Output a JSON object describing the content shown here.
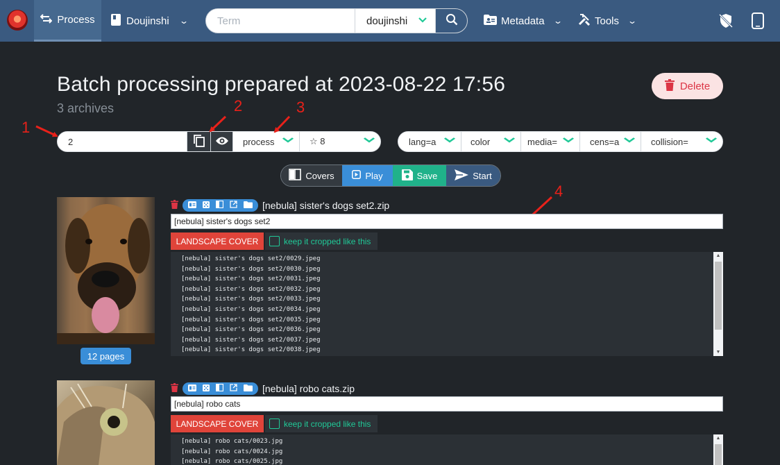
{
  "nav": {
    "process_label": "Process",
    "category_label": "Doujinshi",
    "search_placeholder": "Term",
    "search_category": "doujinshi",
    "metadata_label": "Metadata",
    "tools_label": "Tools"
  },
  "header": {
    "title": "Batch processing prepared at 2023-08-22 17:56",
    "subtitle": "3 archives",
    "delete_label": "Delete"
  },
  "controls": {
    "count_value": "2",
    "mode_select": "process",
    "rating_select": "☆ 8",
    "filters": [
      "lang=a",
      "color",
      "media=",
      "cens=a",
      "collision="
    ]
  },
  "annotations": [
    "1",
    "2",
    "3",
    "4"
  ],
  "actions": {
    "covers_label": "Covers",
    "play_label": "Play",
    "save_label": "Save",
    "start_label": "Start"
  },
  "archives": [
    {
      "filename": "[nebula] sister's dogs set2.zip",
      "title": "[nebula] sister's dogs set2",
      "pages_label": "12 pages",
      "landscape_label": "LANDSCAPE COVER",
      "keep_label": "keep it cropped like this",
      "files": [
        "[nebula] sister's dogs set2/0029.jpeg",
        "[nebula] sister's dogs set2/0030.jpeg",
        "[nebula] sister's dogs set2/0031.jpeg",
        "[nebula] sister's dogs set2/0032.jpeg",
        "[nebula] sister's dogs set2/0033.jpeg",
        "[nebula] sister's dogs set2/0034.jpeg",
        "[nebula] sister's dogs set2/0035.jpeg",
        "[nebula] sister's dogs set2/0036.jpeg",
        "[nebula] sister's dogs set2/0037.jpeg",
        "[nebula] sister's dogs set2/0038.jpeg"
      ]
    },
    {
      "filename": "[nebula] robo cats.zip",
      "title": "[nebula] robo cats",
      "landscape_label": "LANDSCAPE COVER",
      "keep_label": "keep it cropped like this",
      "files": [
        "[nebula] robo cats/0023.jpg",
        "[nebula] robo cats/0024.jpg",
        "[nebula] robo cats/0025.jpg"
      ]
    }
  ]
}
